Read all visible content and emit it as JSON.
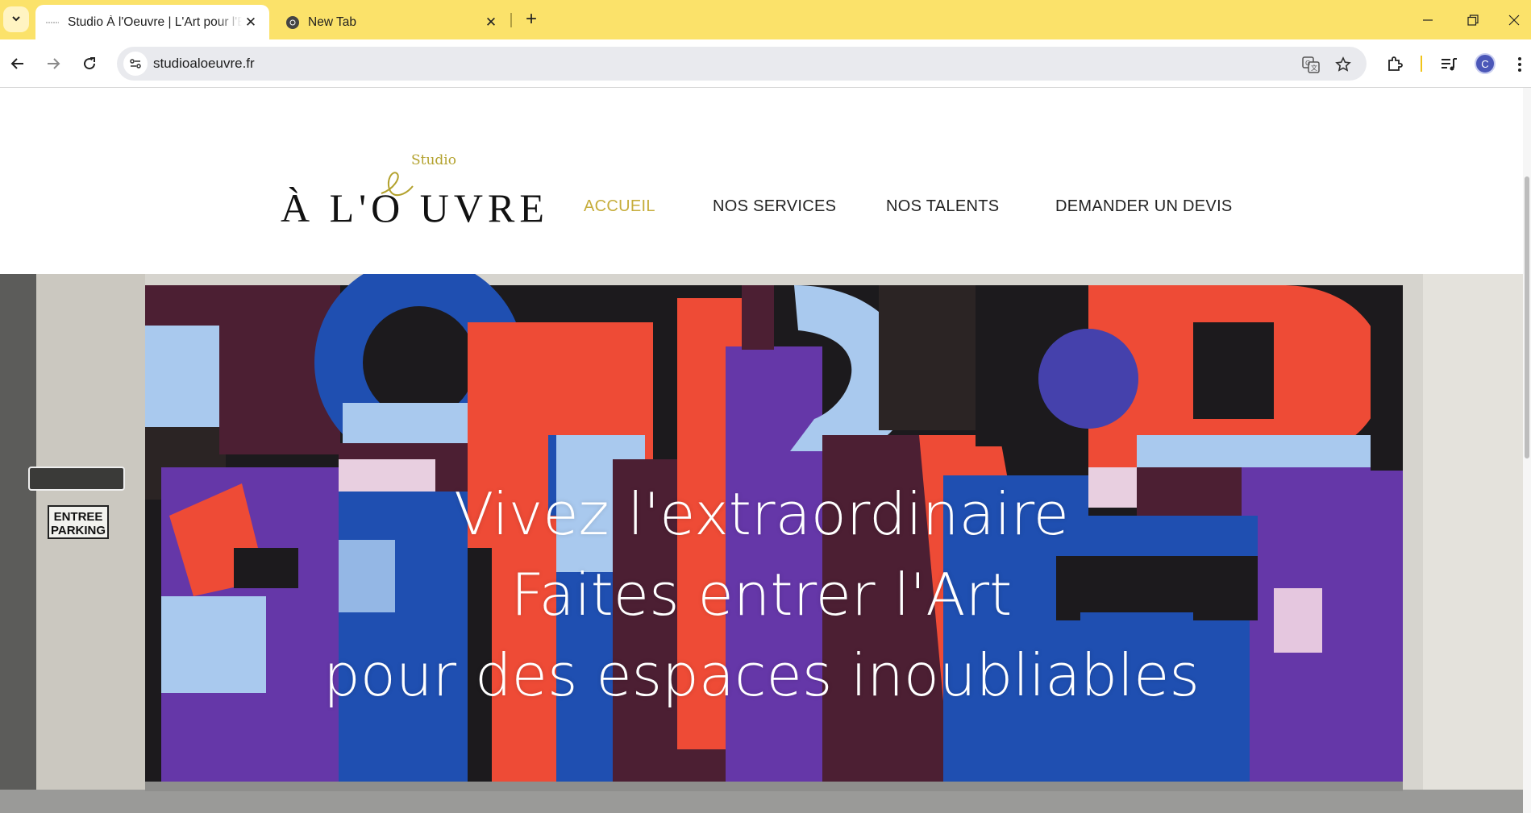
{
  "browser": {
    "tabs": [
      {
        "title": "Studio À l'Oeuvre | L'Art pour l'E",
        "active": true
      },
      {
        "title": "New Tab",
        "active": false
      }
    ],
    "url": "studioaloeuvre.fr",
    "profile_initial": "C",
    "accent_color": "#fbe26a"
  },
  "logo": {
    "studio": "Studio",
    "main": "À L'O  UVRE",
    "script_letter": "e"
  },
  "nav": {
    "items": [
      {
        "label": "ACCUEIL",
        "active": true
      },
      {
        "label": "NOS SERVICES",
        "active": false
      },
      {
        "label": "NOS TALENTS",
        "active": false
      },
      {
        "label": "DEMANDER UN DEVIS",
        "active": false
      }
    ],
    "active_color": "#c6ad3b"
  },
  "hero": {
    "line1": "Vivez l'extraordinaire",
    "line2": "Faites entrer l'Art",
    "line3": "pour des espaces inoubliables",
    "sign": [
      "ENTREE",
      "PARKING"
    ]
  }
}
